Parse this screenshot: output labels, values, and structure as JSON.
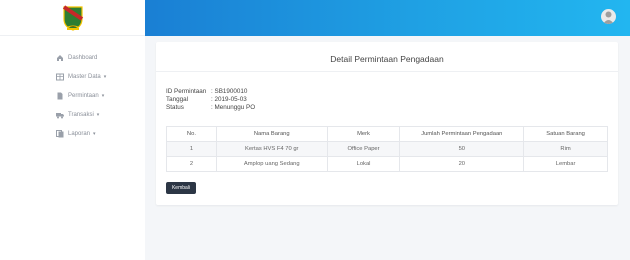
{
  "sidebar": {
    "items": [
      {
        "label": "Dashboard",
        "icon": "home-icon",
        "has_caret": false
      },
      {
        "label": "Master Data",
        "icon": "table-icon",
        "has_caret": true
      },
      {
        "label": "Permintaan",
        "icon": "file-icon",
        "has_caret": true
      },
      {
        "label": "Transaksi",
        "icon": "truck-icon",
        "has_caret": true
      },
      {
        "label": "Laporan",
        "icon": "copy-icon",
        "has_caret": true
      }
    ]
  },
  "topbar": {
    "accent_start": "#1a7fd4",
    "accent_end": "#22b6f0"
  },
  "card": {
    "title": "Detail Permintaan Pengadaan",
    "info": [
      {
        "label": "ID Permintaan",
        "value": ": SB1900010"
      },
      {
        "label": "Tanggal",
        "value": ": 2019-05-03"
      },
      {
        "label": "Status",
        "value": ": Menunggu PO"
      }
    ],
    "table": {
      "headers": [
        "No.",
        "Nama Barang",
        "Merk",
        "Jumlah Permintaan Pengadaan",
        "Satuan Barang"
      ],
      "rows": [
        [
          "1",
          "Kertas HVS F4 70 gr",
          "Office Paper",
          "50",
          "Rim"
        ],
        [
          "2",
          "Amplop uang Sedang",
          "Lokal",
          "20",
          "Lembar"
        ]
      ]
    },
    "back_label": "Kembali"
  }
}
